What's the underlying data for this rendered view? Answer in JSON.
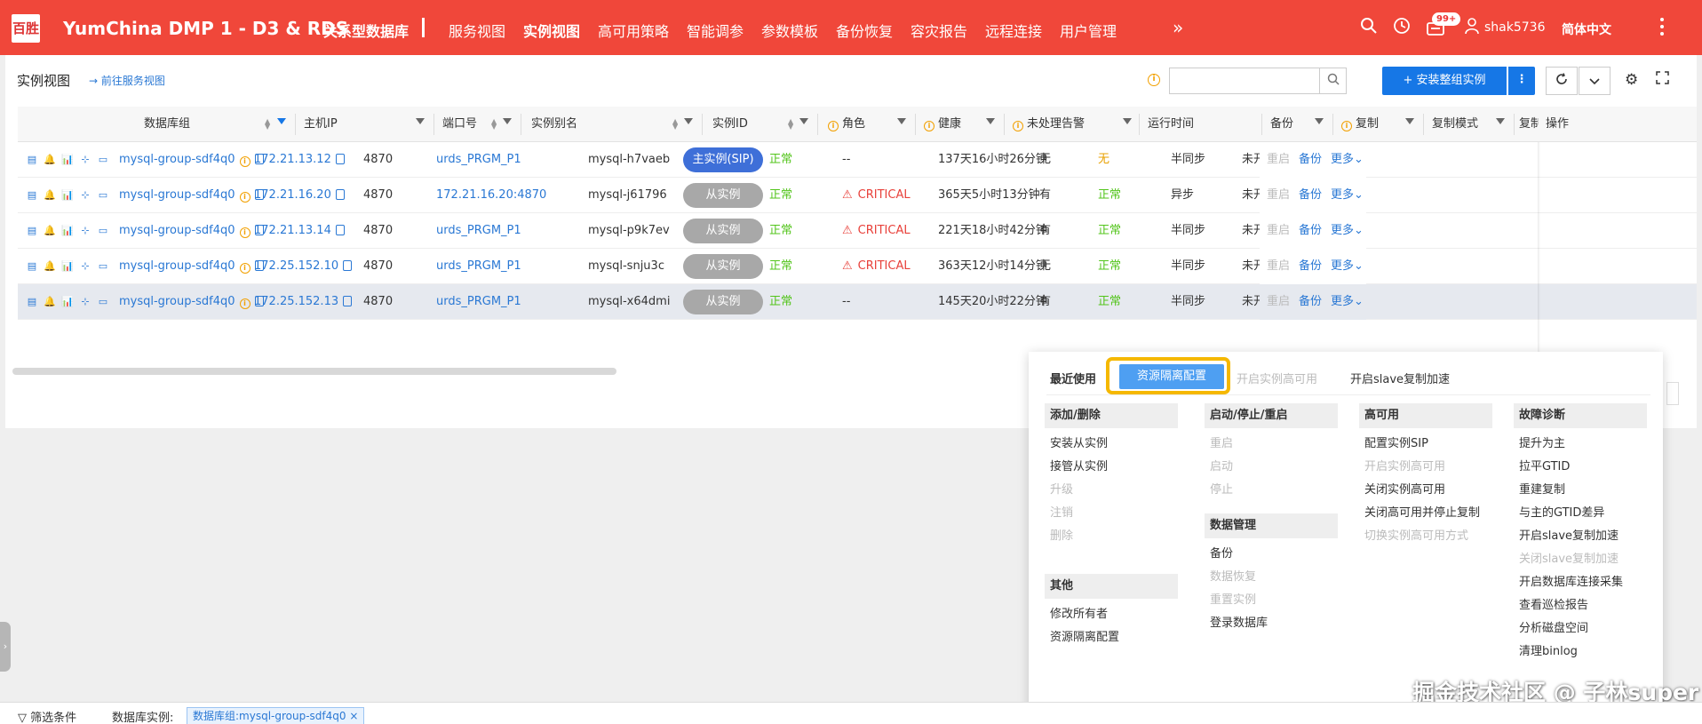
{
  "app": {
    "logo": "百胜",
    "title": "YumChina DMP 1 - D3 & RDS"
  },
  "nav": {
    "db_label": "关系型数据库",
    "items": [
      {
        "label": "服务视图",
        "active": false
      },
      {
        "label": "实例视图",
        "active": true
      },
      {
        "label": "高可用策略",
        "active": false
      },
      {
        "label": "智能调参",
        "active": false
      },
      {
        "label": "参数模板",
        "active": false
      },
      {
        "label": "备份恢复",
        "active": false
      },
      {
        "label": "容灾报告",
        "active": false
      },
      {
        "label": "远程连接",
        "active": false
      },
      {
        "label": "用户管理",
        "active": false
      }
    ],
    "more": "»"
  },
  "topbar": {
    "badge": "99+",
    "username": "shak5736",
    "language": "简体中文"
  },
  "page": {
    "title": "实例视图",
    "goto_link": "前往服务视图",
    "install_button": "+ 安装整组实例"
  },
  "columns": [
    "数据库组",
    "主机IP",
    "端口号",
    "实例别名",
    "实例ID",
    "角色",
    "健康",
    "未处理告警",
    "运行时间",
    "备份",
    "复制",
    "复制模式",
    "复制",
    "操作"
  ],
  "rows": [
    {
      "group": "mysql-group-sdf4q0",
      "ip": "172.21.13.12",
      "port": "4870",
      "alias": "urds_PRGM_P1",
      "id": "mysql-h7vaeb",
      "role": "主实例(SIP)",
      "health": "正常",
      "alert": "--",
      "uptime": "137天16小时26分钟",
      "backup": "无",
      "repl": "无",
      "repl_mode": "半同步",
      "repl2": "未开",
      "op_restart": "重启",
      "op_backup": "备份",
      "op_more": "更多"
    },
    {
      "group": "mysql-group-sdf4q0",
      "ip": "172.21.16.20",
      "port": "4870",
      "alias": "172.21.16.20:4870",
      "id": "mysql-j61796",
      "role": "从实例",
      "health": "正常",
      "alert": "CRITICAL",
      "uptime": "365天5小时13分钟",
      "backup": "有",
      "repl": "正常",
      "repl_mode": "异步",
      "repl2": "未开",
      "op_restart": "重启",
      "op_backup": "备份",
      "op_more": "更多"
    },
    {
      "group": "mysql-group-sdf4q0",
      "ip": "172.21.13.14",
      "port": "4870",
      "alias": "urds_PRGM_P1",
      "id": "mysql-p9k7ev",
      "role": "从实例",
      "health": "正常",
      "alert": "CRITICAL",
      "uptime": "221天18小时42分钟",
      "backup": "有",
      "repl": "正常",
      "repl_mode": "半同步",
      "repl2": "未开",
      "op_restart": "重启",
      "op_backup": "备份",
      "op_more": "更多"
    },
    {
      "group": "mysql-group-sdf4q0",
      "ip": "172.25.152.10",
      "port": "4870",
      "alias": "urds_PRGM_P1",
      "id": "mysql-snju3c",
      "role": "从实例",
      "health": "正常",
      "alert": "CRITICAL",
      "uptime": "363天12小时14分钟",
      "backup": "无",
      "repl": "正常",
      "repl_mode": "半同步",
      "repl2": "未开",
      "op_restart": "重启",
      "op_backup": "备份",
      "op_more": "更多"
    },
    {
      "group": "mysql-group-sdf4q0",
      "ip": "172.25.152.13",
      "port": "4870",
      "alias": "urds_PRGM_P1",
      "id": "mysql-x64dmi",
      "role": "从实例",
      "health": "正常",
      "alert": "--",
      "uptime": "145天20小时22分钟",
      "backup": "有",
      "repl": "正常",
      "repl_mode": "半同步",
      "repl2": "未开",
      "op_restart": "重启",
      "op_backup": "备份",
      "op_more": "更多"
    }
  ],
  "dropdown": {
    "recent_label": "最近使用",
    "recent": [
      {
        "label": "资源隔离配置",
        "disabled": false
      },
      {
        "label": "开启实例高可用",
        "disabled": true
      },
      {
        "label": "开启slave复制加速",
        "disabled": false
      }
    ],
    "sections": [
      {
        "title": "添加/删除",
        "items": [
          {
            "label": "安装从实例",
            "disabled": false
          },
          {
            "label": "接管从实例",
            "disabled": false
          },
          {
            "label": "升级",
            "disabled": true
          },
          {
            "label": "注销",
            "disabled": true
          },
          {
            "label": "删除",
            "disabled": true
          }
        ]
      },
      {
        "title": "其他",
        "items": [
          {
            "label": "修改所有者",
            "disabled": false
          },
          {
            "label": "资源隔离配置",
            "disabled": false
          }
        ]
      },
      {
        "title": "启动/停止/重启",
        "items": [
          {
            "label": "重启",
            "disabled": true
          },
          {
            "label": "启动",
            "disabled": true
          },
          {
            "label": "停止",
            "disabled": true
          }
        ]
      },
      {
        "title": "数据管理",
        "items": [
          {
            "label": "备份",
            "disabled": false
          },
          {
            "label": "数据恢复",
            "disabled": true
          },
          {
            "label": "重置实例",
            "disabled": true
          },
          {
            "label": "登录数据库",
            "disabled": false
          }
        ]
      },
      {
        "title": "高可用",
        "items": [
          {
            "label": "配置实例SIP",
            "disabled": false
          },
          {
            "label": "开启实例高可用",
            "disabled": true
          },
          {
            "label": "关闭实例高可用",
            "disabled": false
          },
          {
            "label": "关闭高可用并停止复制",
            "disabled": false
          },
          {
            "label": "切换实例高可用方式",
            "disabled": true
          }
        ]
      },
      {
        "title": "故障诊断",
        "items": [
          {
            "label": "提升为主",
            "disabled": false
          },
          {
            "label": "拉平GTID",
            "disabled": false
          },
          {
            "label": "重建复制",
            "disabled": false
          },
          {
            "label": "与主的GTID差异",
            "disabled": false
          },
          {
            "label": "开启slave复制加速",
            "disabled": false
          },
          {
            "label": "关闭slave复制加速",
            "disabled": true
          },
          {
            "label": "开启数据库连接采集",
            "disabled": false
          },
          {
            "label": "查看巡检报告",
            "disabled": false
          },
          {
            "label": "分析磁盘空间",
            "disabled": false
          },
          {
            "label": "清理binlog",
            "disabled": false
          }
        ]
      }
    ]
  },
  "filter": {
    "label": "筛选条件",
    "field": "数据库实例:",
    "tag": "数据库组:mysql-group-sdf4q0 ×"
  },
  "watermark": "掘金技术社区 @ 子林super",
  "colors": {
    "topbar": "#f0473a",
    "primary": "#1677e6",
    "ok": "#52c41a",
    "critical": "#e8403a",
    "warning": "#f2a000",
    "highlight": "#f5b800"
  }
}
